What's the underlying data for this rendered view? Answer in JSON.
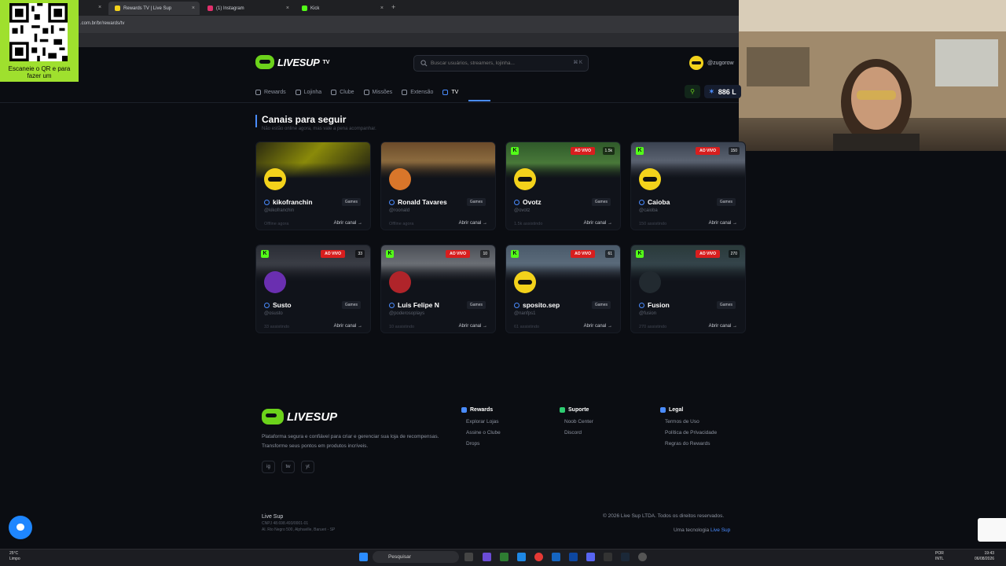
{
  "browser": {
    "tabs": [
      {
        "label": "Rewards TV | Live Sup",
        "color": "#f3d21b",
        "active": true
      },
      {
        "label": "(1) Instagram",
        "color": "#e1306c",
        "active": false
      },
      {
        "label": "Kick",
        "color": "#53fc18",
        "active": false
      }
    ],
    "url": ".com.br/br/rewards/tv",
    "new_tab": "+",
    "close": "×"
  },
  "overlay": {
    "qr_text": "Escaneie o QR e para fazer um"
  },
  "header": {
    "logo": "LIVESUP",
    "logo_suffix": "TV",
    "search_placeholder": "Buscar usuários, streamers, lojinha...",
    "search_shortcut": "⌘ K",
    "username": "@zugorow",
    "points": "886 L"
  },
  "nav": [
    {
      "label": "Rewards",
      "active": false
    },
    {
      "label": "Lojinha",
      "active": false
    },
    {
      "label": "Clube",
      "active": false
    },
    {
      "label": "Missões",
      "active": false
    },
    {
      "label": "Extensão",
      "active": false
    },
    {
      "label": "TV",
      "active": true
    }
  ],
  "section": {
    "title": "Canais para seguir",
    "subtitle": "Não estão online agora, mas vale a pena acompanhar."
  },
  "channels": [
    {
      "name": "kikofranchin",
      "handle": "@kikofranchin",
      "category": "Games",
      "status": "Offline agora",
      "live": false,
      "live_label": "",
      "viewers": "",
      "open": "Abrir canal →",
      "avatar": "yellow",
      "thumb": "linear-gradient(135deg,#2b2a10 0%,#8a8a0a 45%,#1a1a12 100%)"
    },
    {
      "name": "Ronald Tavares",
      "handle": "@roonald",
      "category": "Games",
      "status": "Offline agora",
      "live": false,
      "live_label": "",
      "viewers": "",
      "open": "Abrir canal →",
      "avatar": "orange",
      "thumb": "linear-gradient(180deg,#6b4a2a 0%,#8a6a3e 50%,#3a2a1a 100%)"
    },
    {
      "name": "Ovotz",
      "handle": "@ovotz",
      "category": "Games",
      "status": "1.5k assistindo",
      "live": true,
      "live_label": "AO VIVO",
      "viewers": "1.5k",
      "open": "Abrir canal →",
      "avatar": "yellow",
      "thumb": "linear-gradient(180deg,#2f5a2a 0%,#4a7a3a 60%,#223a1c 100%)"
    },
    {
      "name": "Caioba",
      "handle": "@caioba",
      "category": "Games",
      "status": "150 assistindo",
      "live": true,
      "live_label": "AO VIVO",
      "viewers": "150",
      "open": "Abrir canal →",
      "avatar": "yellow",
      "thumb": "linear-gradient(180deg,#3a4250 0%,#5a6270 50%,#262a33 100%)"
    },
    {
      "name": "Susto",
      "handle": "@osusto",
      "category": "Games",
      "status": "33 assistindo",
      "live": true,
      "live_label": "AO VIVO",
      "viewers": "33",
      "open": "Abrir canal →",
      "avatar": "purple",
      "thumb": "linear-gradient(180deg,#2a2d35 0%,#3a3d45 50%,#1c1e24 100%)"
    },
    {
      "name": "Luis Felipe N",
      "handle": "@poderosoplays",
      "category": "Games",
      "status": "10 assistindo",
      "live": true,
      "live_label": "AO VIVO",
      "viewers": "10",
      "open": "Abrir canal →",
      "avatar": "red",
      "thumb": "linear-gradient(180deg,#4a4e56 0%,#6a6e74 50%,#2a2c32 100%)"
    },
    {
      "name": "sposito.sep",
      "handle": "@nanfps1",
      "category": "Games",
      "status": "61 assistindo",
      "live": true,
      "live_label": "AO VIVO",
      "viewers": "61",
      "open": "Abrir canal →",
      "avatar": "yellow",
      "thumb": "linear-gradient(180deg,#4a5a6a 0%,#5a6a7a 50%,#22262e 100%)"
    },
    {
      "name": "Fusion",
      "handle": "@fusion",
      "category": "Games",
      "status": "270 assistindo",
      "live": true,
      "live_label": "AO VIVO",
      "viewers": "270",
      "open": "Abrir canal →",
      "avatar": "dark",
      "thumb": "linear-gradient(180deg,#2a3a3a 0%,#34444a 50%,#1a2226 100%)"
    }
  ],
  "footer": {
    "logo": "LIVESUP",
    "description": "Plataforma segura e confiável para criar e gerenciar sua loja de recompensas. Transforme seus pontos em produtos incríveis.",
    "socials": [
      "ig",
      "tw",
      "yt"
    ],
    "columns": [
      {
        "title": "Rewards",
        "color": "#4a8cff",
        "links": [
          "Explorar Lojas",
          "Assine o Clube",
          "Drops"
        ]
      },
      {
        "title": "Suporte",
        "color": "#2ecc71",
        "links": [
          "Noob Center",
          "Discord"
        ]
      },
      {
        "title": "Legal",
        "color": "#4a8cff",
        "links": [
          "Termos de Uso",
          "Política de Privacidade",
          "Regras do Rewards"
        ]
      }
    ],
    "company": "Live Sup",
    "cnpj": "CNPJ 48.698.493/0001-01",
    "address": "Al. Rio Negro 500, Alphaville, Barueri - SP",
    "copyright": "© 2026 Live Sup LTDA. Todos os direitos reservados.",
    "tech_prefix": "Uma tecnologia",
    "tech_brand": "Live Sup"
  },
  "taskbar": {
    "temp": "25°C",
    "weather": "Limpo",
    "search": "Pesquisar",
    "lang": "POR",
    "layout": "INTL",
    "time": "19:43",
    "date": "06/08/2026"
  }
}
